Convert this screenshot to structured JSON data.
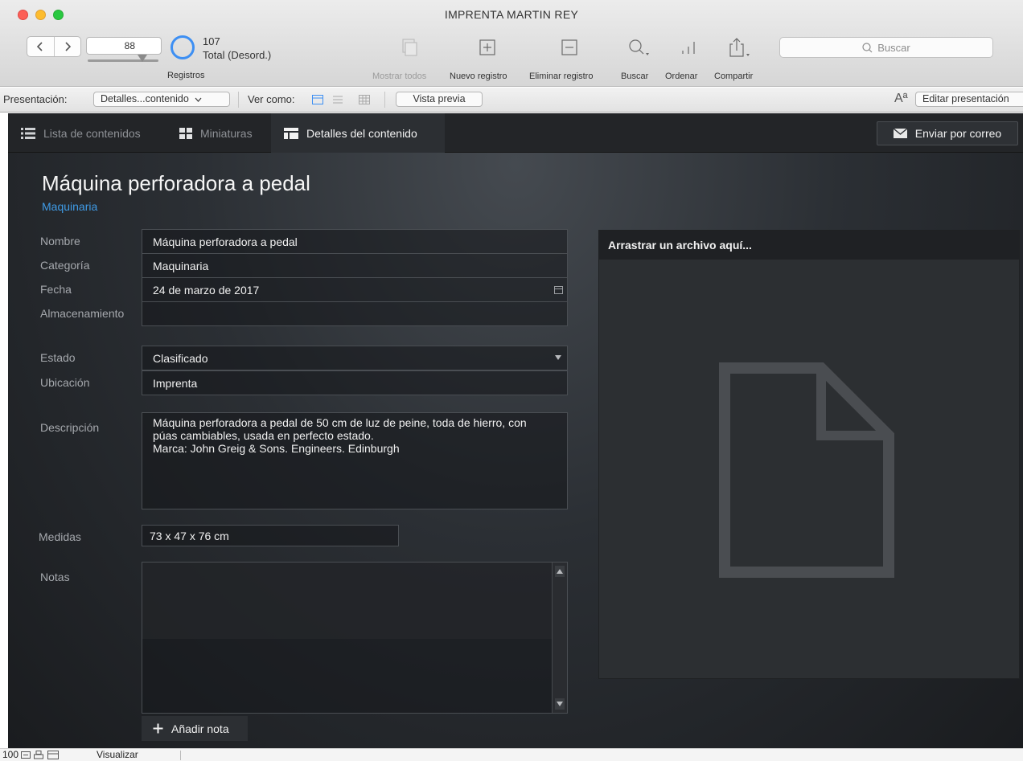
{
  "window": {
    "title": "IMPRENTA MARTIN REY"
  },
  "toolbar": {
    "record_number": "88",
    "total_count": "107",
    "total_label": "Total (Desord.)",
    "records_label": "Registros",
    "show_all": "Mostrar todos",
    "new_record": "Nuevo registro",
    "delete_record": "Eliminar registro",
    "find": "Buscar",
    "sort": "Ordenar",
    "share": "Compartir",
    "search_placeholder": "Buscar"
  },
  "layoutbar": {
    "layout_label": "Presentación:",
    "layout_value": "Detalles...contenido",
    "view_as_label": "Ver como:",
    "preview_button": "Vista previa",
    "font_icon_label": "Aª",
    "edit_layout_button": "Editar presentación"
  },
  "tabs": [
    {
      "label": "Lista de contenidos"
    },
    {
      "label": "Miniaturas"
    },
    {
      "label": "Detalles del contenido"
    }
  ],
  "email_button": "Enviar por correo",
  "record": {
    "title": "Máquina perforadora a pedal",
    "category_link": "Maquinaria"
  },
  "fields": {
    "name": {
      "label": "Nombre",
      "value": "Máquina perforadora a pedal"
    },
    "category": {
      "label": "Categoría",
      "value": "Maquinaria"
    },
    "date": {
      "label": "Fecha",
      "value": "24 de marzo de 2017"
    },
    "storage": {
      "label": "Almacenamiento",
      "value": ""
    },
    "status": {
      "label": "Estado",
      "value": "Clasificado"
    },
    "location": {
      "label": "Ubicación",
      "value": "Imprenta"
    },
    "description": {
      "label": "Descripción",
      "lines": [
        "Máquina perforadora a pedal de 50 cm de luz de peine, toda de hierro, con",
        "púas cambiables, usada en perfecto estado.",
        "Marca: John Greig & Sons. Engineers. Edinburgh"
      ]
    },
    "measures": {
      "label": "Medidas",
      "value": "73 x 47 x 76 cm"
    },
    "notes": {
      "label": "Notas"
    }
  },
  "add_note_button": "Añadir nota",
  "drop_panel": {
    "header": "Arrastrar un archivo aquí..."
  },
  "statusbar": {
    "zoom": "100",
    "mode": "Visualizar"
  },
  "colors": {
    "accent": "#3f9be6",
    "record_circle": "#3d8ff3",
    "content_bg": "#2b2f34"
  }
}
